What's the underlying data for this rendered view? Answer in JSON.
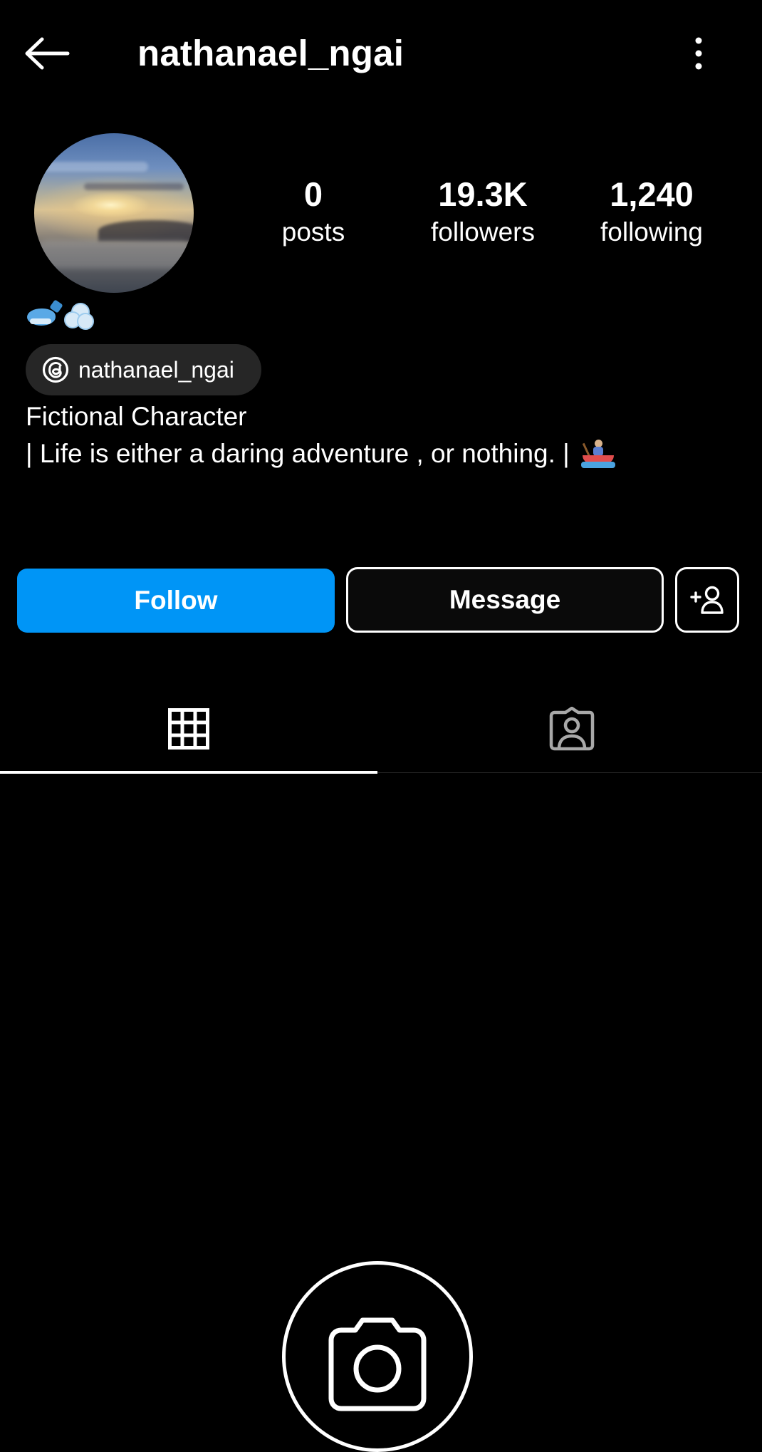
{
  "header": {
    "username": "nathanael_ngai",
    "back_icon": "arrow-left-icon",
    "more_icon": "vertical-dots-icon"
  },
  "stats": {
    "posts": {
      "value": "0",
      "label": "posts"
    },
    "followers": {
      "value": "19.3K",
      "label": "followers"
    },
    "following": {
      "value": "1,240",
      "label": "following"
    }
  },
  "profile": {
    "emoji_icons": [
      "whale-icon",
      "dash-puff-icon"
    ],
    "threads_badge": {
      "icon": "threads-icon",
      "label": "nathanael_ngai"
    },
    "category": "Fictional Character",
    "bio": "| Life is either a daring adventure , or nothing. |",
    "bio_emoji_icon": "person-rowing-boat-icon"
  },
  "actions": {
    "follow": "Follow",
    "message": "Message",
    "add_user_icon": "add-person-icon"
  },
  "tabs": [
    {
      "icon": "grid-icon",
      "active": true
    },
    {
      "icon": "tagged-person-icon",
      "active": false
    }
  ],
  "empty_state": {
    "icon": "camera-icon"
  },
  "colors": {
    "background": "#000000",
    "primary_button": "#0095f6",
    "badge_background": "#262626",
    "text": "#ffffff"
  }
}
